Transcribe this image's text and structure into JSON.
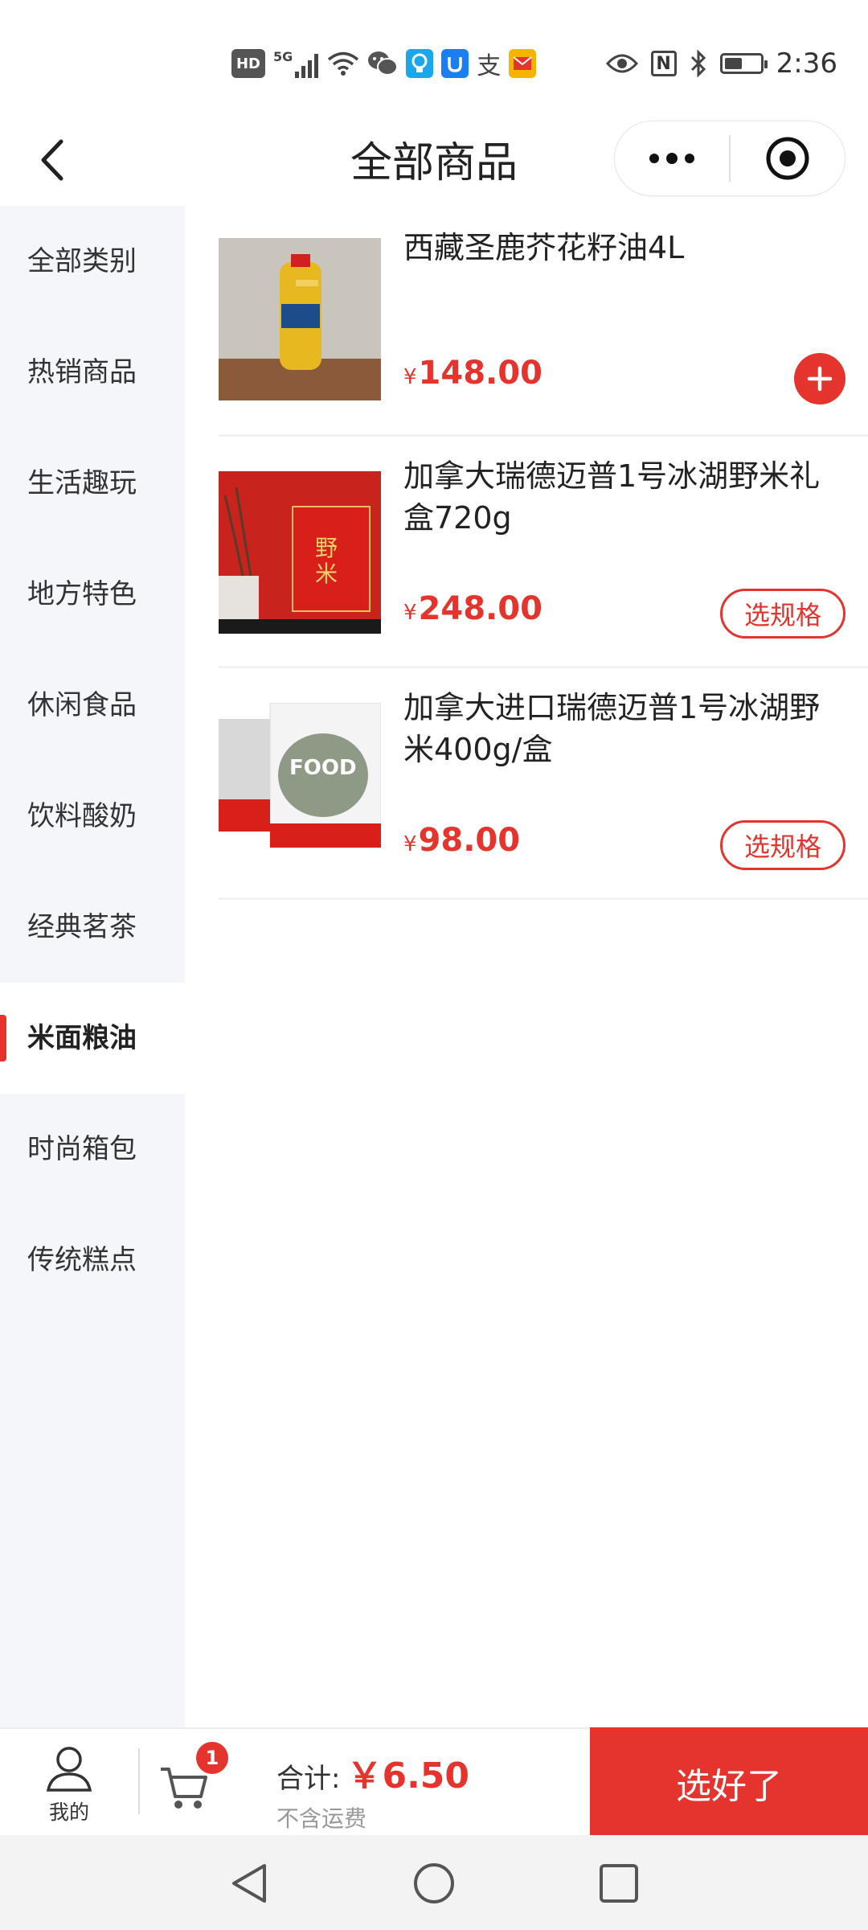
{
  "status_bar": {
    "left_icons": [
      "hd-icon",
      "signal-5g-icon",
      "wifi-icon",
      "wechat-icon",
      "bulb-icon",
      "u-app-icon",
      "alipay-icon",
      "mail-icon"
    ],
    "hd_label": "HD",
    "network_label": "5G",
    "alipay_char": "支",
    "right_icons": [
      "eye-icon",
      "nfc-icon",
      "bluetooth-icon",
      "battery-icon"
    ],
    "nfc_label": "N",
    "battery_level": 0.45,
    "time": "2:36"
  },
  "nav": {
    "title": "全部商品"
  },
  "sidebar": {
    "items": [
      {
        "label": "全部类别",
        "active": false
      },
      {
        "label": "热销商品",
        "active": false
      },
      {
        "label": "生活趣玩",
        "active": false
      },
      {
        "label": "地方特色",
        "active": false
      },
      {
        "label": "休闲食品",
        "active": false
      },
      {
        "label": "饮料酸奶",
        "active": false
      },
      {
        "label": "经典茗茶",
        "active": false
      },
      {
        "label": "米面粮油",
        "active": true
      },
      {
        "label": "时尚箱包",
        "active": false
      },
      {
        "label": "传统糕点",
        "active": false
      }
    ]
  },
  "products": [
    {
      "name": "西藏圣鹿芥花籽油4L",
      "currency": "¥",
      "price": "148.00",
      "action": "add"
    },
    {
      "name": "加拿大瑞德迈普1号冰湖野米礼盒720g",
      "currency": "¥",
      "price": "248.00",
      "action_label": "选规格"
    },
    {
      "name": "加拿大进口瑞德迈普1号冰湖野米400g/盒",
      "currency": "¥",
      "price": "98.00",
      "action_label": "选规格"
    }
  ],
  "product_images": {
    "box_char": "野米",
    "food_label": "FOOD"
  },
  "bottom_bar": {
    "me_label": "我的",
    "cart_count": "1",
    "total_label": "合计:",
    "total_amount": "￥6.50",
    "shipping_note": "不含运费",
    "checkout_label": "选好了"
  },
  "colors": {
    "accent": "#e5342e",
    "sidebar_bg": "#f5f6fa"
  }
}
